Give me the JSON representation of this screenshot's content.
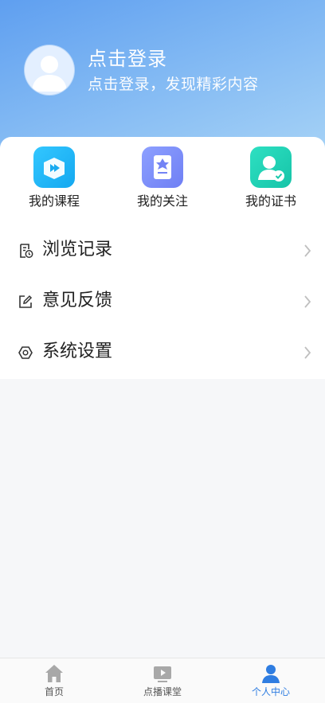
{
  "profile": {
    "title": "点击登录",
    "subtitle": "点击登录，发现精彩内容",
    "avatar_icon": "user-avatar-icon"
  },
  "quick_actions": [
    {
      "label": "我的课程",
      "icon": "course-play-icon",
      "color": "#1fb4f5"
    },
    {
      "label": "我的关注",
      "icon": "follow-bookmark-icon",
      "color": "#7b8cf8"
    },
    {
      "label": "我的证书",
      "icon": "certificate-user-icon",
      "color": "#1fd1b5"
    }
  ],
  "menu": [
    {
      "label": "浏览记录",
      "icon": "history-icon"
    },
    {
      "label": "意见反馈",
      "icon": "feedback-edit-icon"
    },
    {
      "label": "系统设置",
      "icon": "settings-icon"
    }
  ],
  "tabbar": {
    "active": "个人中心",
    "active_color": "#2f7de1",
    "items": [
      {
        "label": "首页",
        "icon": "home-icon"
      },
      {
        "label": "点播课堂",
        "icon": "video-play-icon"
      },
      {
        "label": "个人中心",
        "icon": "profile-icon"
      }
    ]
  }
}
